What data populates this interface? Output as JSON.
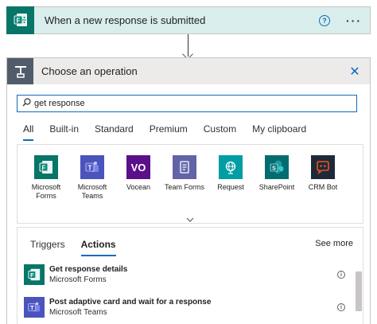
{
  "trigger": {
    "title": "When a new response is submitted",
    "help": "?",
    "more": "···",
    "color": "#077568"
  },
  "operation": {
    "title": "Choose an operation",
    "close": "✕",
    "search_value": "get response",
    "tabs": [
      "All",
      "Built-in",
      "Standard",
      "Premium",
      "Custom",
      "My clipboard"
    ],
    "active_tab": "All"
  },
  "connectors": [
    {
      "label": "Microsoft Forms",
      "icon": "microsoft-forms-icon",
      "color": "#077568"
    },
    {
      "label": "Microsoft Teams",
      "icon": "microsoft-teams-icon",
      "color": "#4b53bc"
    },
    {
      "label": "Vocean",
      "icon": "vocean-icon",
      "color": "#5c0f8b"
    },
    {
      "label": "Team Forms",
      "icon": "team-forms-icon",
      "color": "#6264a7"
    },
    {
      "label": "Request",
      "icon": "request-icon",
      "color": "#009da5"
    },
    {
      "label": "SharePoint",
      "icon": "sharepoint-icon",
      "color": "#036c70"
    },
    {
      "label": "CRM Bot",
      "icon": "crm-bot-icon",
      "color": "#1e2a38"
    }
  ],
  "actions_panel": {
    "tabs": [
      "Triggers",
      "Actions"
    ],
    "active_tab": "Actions",
    "see_more": "See more",
    "items": [
      {
        "name": "Get response details",
        "source": "Microsoft Forms",
        "icon": "microsoft-forms-icon",
        "color": "#077568"
      },
      {
        "name": "Post adaptive card and wait for a response",
        "source": "Microsoft Teams",
        "icon": "microsoft-teams-icon",
        "color": "#4b53bc"
      }
    ]
  }
}
